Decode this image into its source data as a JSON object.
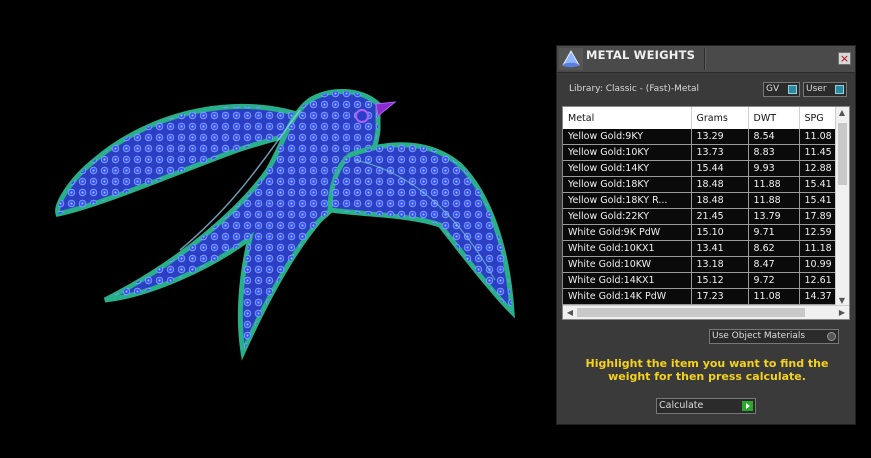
{
  "panel": {
    "title": "METAL WEIGHTS",
    "close_label": "×",
    "library_label": "Library: Classic - (Fast)-Metal",
    "toggle_gv": "GV",
    "toggle_user": "User",
    "columns": [
      "Metal",
      "Grams",
      "DWT",
      "SPG"
    ],
    "rows": [
      [
        "Yellow Gold:9KY",
        "13.29",
        "8.54",
        "11.08"
      ],
      [
        "Yellow Gold:10KY",
        "13.73",
        "8.83",
        "11.45"
      ],
      [
        "Yellow Gold:14KY",
        "15.44",
        "9.93",
        "12.88"
      ],
      [
        "Yellow Gold:18KY",
        "18.48",
        "11.88",
        "15.41"
      ],
      [
        "Yellow Gold:18KY R...",
        "18.48",
        "11.88",
        "15.41"
      ],
      [
        "Yellow Gold:22KY",
        "21.45",
        "13.79",
        "17.89"
      ],
      [
        "White Gold:9K PdW",
        "15.10",
        "9.71",
        "12.59"
      ],
      [
        "White Gold:10KX1",
        "13.41",
        "8.62",
        "11.18"
      ],
      [
        "White Gold:10KW",
        "13.18",
        "8.47",
        "10.99"
      ],
      [
        "White Gold:14KX1",
        "15.12",
        "9.72",
        "12.61"
      ],
      [
        "White Gold:14K PdW",
        "17.23",
        "11.08",
        "14.37"
      ]
    ],
    "use_object_materials": "Use Object Materials",
    "hint": "Highlight the item you want to find the weight for then press calculate.",
    "calculate_label": "Calculate",
    "accent_color": "#f5d21e"
  },
  "viewport": {
    "model_colors": {
      "body": "#2a3fc4",
      "outline": "#27b08a",
      "beak": "#8a2ad0"
    }
  }
}
